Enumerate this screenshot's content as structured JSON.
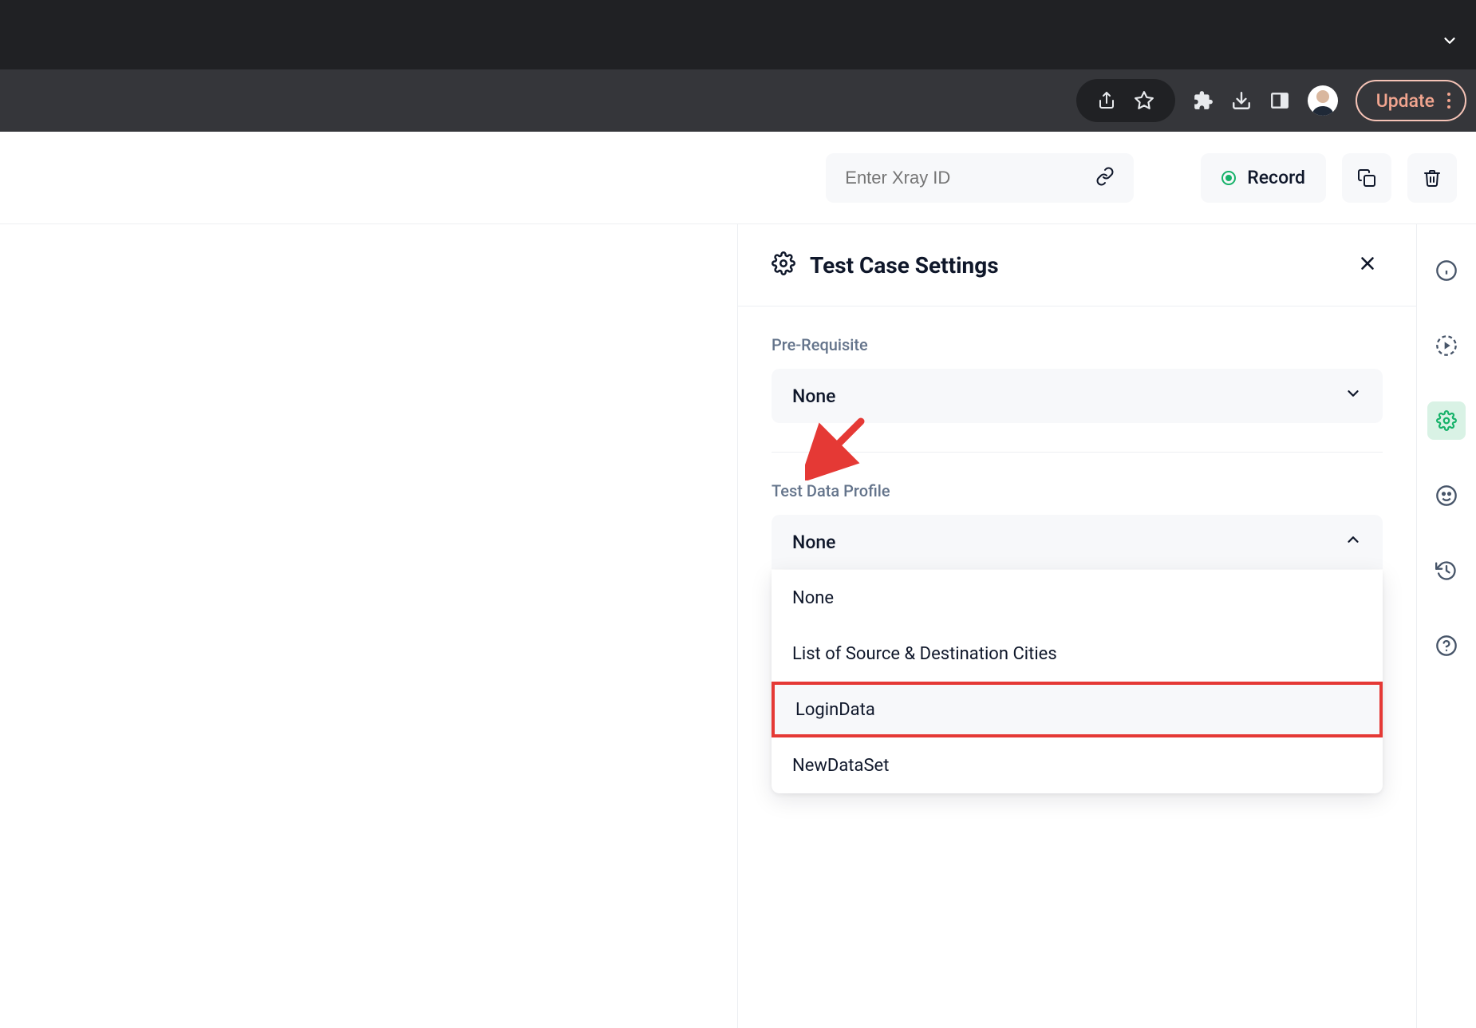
{
  "browser": {
    "update_label": "Update"
  },
  "header": {
    "xray_placeholder": "Enter Xray ID",
    "record_label": "Record"
  },
  "panel": {
    "title": "Test Case Settings",
    "prereq_label": "Pre-Requisite",
    "prereq_value": "None",
    "tdp_label": "Test Data Profile",
    "tdp_value": "None",
    "tdp_options": {
      "none": "None",
      "cities": "List of Source & Destination Cities",
      "login": "LoginData",
      "newds": "NewDataSet"
    }
  }
}
